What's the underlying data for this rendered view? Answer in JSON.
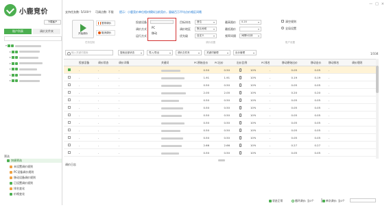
{
  "app": {
    "logo_text": "小鹿竞价",
    "logo_sub": "",
    "download_btn": "下载客户"
  },
  "left": {
    "tabs": [
      "账户列表",
      "调价文件夹"
    ],
    "search_placeholder": "",
    "tree": [
      {
        "label": "",
        "checked": true,
        "level": 0
      },
      {
        "label": "",
        "checked": true,
        "level": 1
      },
      {
        "label": "",
        "checked": true,
        "level": 1
      },
      {
        "label": "",
        "checked": true,
        "level": 1
      },
      {
        "label": "",
        "checked": true,
        "level": 1
      },
      {
        "label": "",
        "checked": true,
        "level": 1
      },
      {
        "label": "",
        "checked": true,
        "level": 1
      }
    ],
    "filter_title": "筛选",
    "filter_main": "快捷筛选",
    "filter_items": [
      "未设置调价规则",
      "PC设备调价规则",
      "移动设备调价规则",
      "已设置调价规则",
      "排名变化",
      "价格变化"
    ]
  },
  "topbar": {
    "task_count": "支持任务数: 5/100个",
    "status": "可调点数: 不限",
    "notice": "提示：小鹿竞价单位相对模拟当前竞价，量级百万平均点价格区间哦",
    "window_controls": [
      "—",
      "□",
      "×"
    ]
  },
  "controls": {
    "start_btn": "开始调价",
    "pause_btn": "暂停调价",
    "cancel_btn": "取消调价",
    "device_label": "投放设备",
    "device_value": "",
    "rank_mode_label": "调价方式",
    "run_mode_label": "运行方式",
    "target_label": "目标排名",
    "target_value": "首位",
    "region_label": "调价地区",
    "region_value": "默认地域",
    "priority_label": "优先级",
    "priority_value": "自定义",
    "max_price_label": "最高限价",
    "max_price_value": "0.20",
    "min_price_label": "最低限价",
    "min_price_value": "",
    "bid_label": "起始出价",
    "bid_value": "",
    "interval_label": "频率间隔",
    "interval_value": "间隔5分钟",
    "extra_label": "",
    "extra_value": "",
    "clear_rules": "清空规则",
    "global_settings": "全局设置",
    "caption_task": "任务控制",
    "caption_rule": "调价设置",
    "caption_account": "账户设置",
    "dropdown_options": [
      "PC",
      "移动"
    ],
    "dropdown_current": ""
  },
  "table_toolbar": {
    "search_placeholder": "输入关键词搜索",
    "filter1": "搜索全部状态",
    "filter2": "导入/导出",
    "filter3": "调价文件夹",
    "filter4": "关键词管理",
    "filter5": "出价管理",
    "page_info": "1/334"
  },
  "table": {
    "columns": [
      "",
      "投放设备",
      "调价状态",
      "调价详情",
      "",
      "关键词",
      "PC原始出价",
      "PC出价",
      "出价比例",
      "",
      "PC排名",
      "移动原始出价",
      "移动出价",
      "移动排名",
      "调价规则"
    ],
    "rows": [
      {
        "checked": true,
        "device": "-",
        "status": "-",
        "detail": "-",
        "kw": "",
        "pc_orig": "0.50",
        "pc_bid": "0.50",
        "ratio": "10%",
        "pc_rank": "-",
        "m_orig": "0.05",
        "m_bid": "0.05",
        "m_rank": "-",
        "rule": ""
      },
      {
        "checked": false,
        "device": "-",
        "status": "-",
        "detail": "-",
        "kw": "",
        "pc_orig": "1.91",
        "pc_bid": "1.91",
        "ratio": "10%",
        "pc_rank": "-",
        "m_orig": "0.19",
        "m_bid": "0.19",
        "m_rank": "-",
        "rule": ""
      },
      {
        "checked": false,
        "device": "-",
        "status": "-",
        "detail": "-",
        "kw": "",
        "pc_orig": "0.50",
        "pc_bid": "0.50",
        "ratio": "10%",
        "pc_rank": "-",
        "m_orig": "0.05",
        "m_bid": "0.05",
        "m_rank": "-",
        "rule": ""
      },
      {
        "checked": false,
        "device": "-",
        "status": "-",
        "detail": "-",
        "kw": "",
        "pc_orig": "2.00",
        "pc_bid": "2.00",
        "ratio": "10%",
        "pc_rank": "-",
        "m_orig": "0.20",
        "m_bid": "0.20",
        "m_rank": "-",
        "rule": ""
      },
      {
        "checked": false,
        "device": "-",
        "status": "-",
        "detail": "-",
        "kw": "",
        "pc_orig": "0.50",
        "pc_bid": "0.50",
        "ratio": "10%",
        "pc_rank": "-",
        "m_orig": "0.05",
        "m_bid": "0.05",
        "m_rank": "-",
        "rule": ""
      },
      {
        "checked": false,
        "device": "-",
        "status": "-",
        "detail": "-",
        "kw": "",
        "pc_orig": "0.50",
        "pc_bid": "0.50",
        "ratio": "10%",
        "pc_rank": "-",
        "m_orig": "0.05",
        "m_bid": "0.05",
        "m_rank": "-",
        "rule": ""
      },
      {
        "checked": false,
        "device": "-",
        "status": "-",
        "detail": "-",
        "kw": "",
        "pc_orig": "0.50",
        "pc_bid": "0.50",
        "ratio": "10%",
        "pc_rank": "-",
        "m_orig": "0.05",
        "m_bid": "0.05",
        "m_rank": "-",
        "rule": ""
      },
      {
        "checked": false,
        "device": "-",
        "status": "-",
        "detail": "-",
        "kw": "",
        "pc_orig": "0.50",
        "pc_bid": "0.50",
        "ratio": "10%",
        "pc_rank": "-",
        "m_orig": "0.05",
        "m_bid": "0.05",
        "m_rank": "-",
        "rule": ""
      },
      {
        "checked": false,
        "device": "-",
        "status": "-",
        "detail": "-",
        "kw": "",
        "pc_orig": "0.50",
        "pc_bid": "0.50",
        "ratio": "10%",
        "pc_rank": "-",
        "m_orig": "0.05",
        "m_bid": "0.05",
        "m_rank": "-",
        "rule": ""
      },
      {
        "checked": false,
        "device": "-",
        "status": "-",
        "detail": "-",
        "kw": "",
        "pc_orig": "0.50",
        "pc_bid": "0.50",
        "ratio": "10%",
        "pc_rank": "-",
        "m_orig": "0.05",
        "m_bid": "0.05",
        "m_rank": "-",
        "rule": ""
      },
      {
        "checked": false,
        "device": "-",
        "status": "-",
        "detail": "-",
        "kw": "",
        "pc_orig": "2.66",
        "pc_bid": "2.66",
        "ratio": "10%",
        "pc_rank": "-",
        "m_orig": "0.27",
        "m_bid": "0.27",
        "m_rank": "-",
        "rule": ""
      },
      {
        "checked": false,
        "device": "-",
        "status": "-",
        "detail": "-",
        "kw": "",
        "pc_orig": "0.50",
        "pc_bid": "0.50",
        "ratio": "10%",
        "pc_rank": "-",
        "m_orig": "0.05",
        "m_bid": "0.05",
        "m_rank": "-",
        "rule": ""
      }
    ]
  },
  "bottom": {
    "log_title": "调价日志",
    "status_ok": "状态正常",
    "refresh_label": "循环调价: 当0个",
    "done_label": "单次调价: 当0个"
  },
  "colors": {
    "accent": "#4caf50",
    "alert": "#d32f2f",
    "selected_row": "#fff3d6"
  }
}
